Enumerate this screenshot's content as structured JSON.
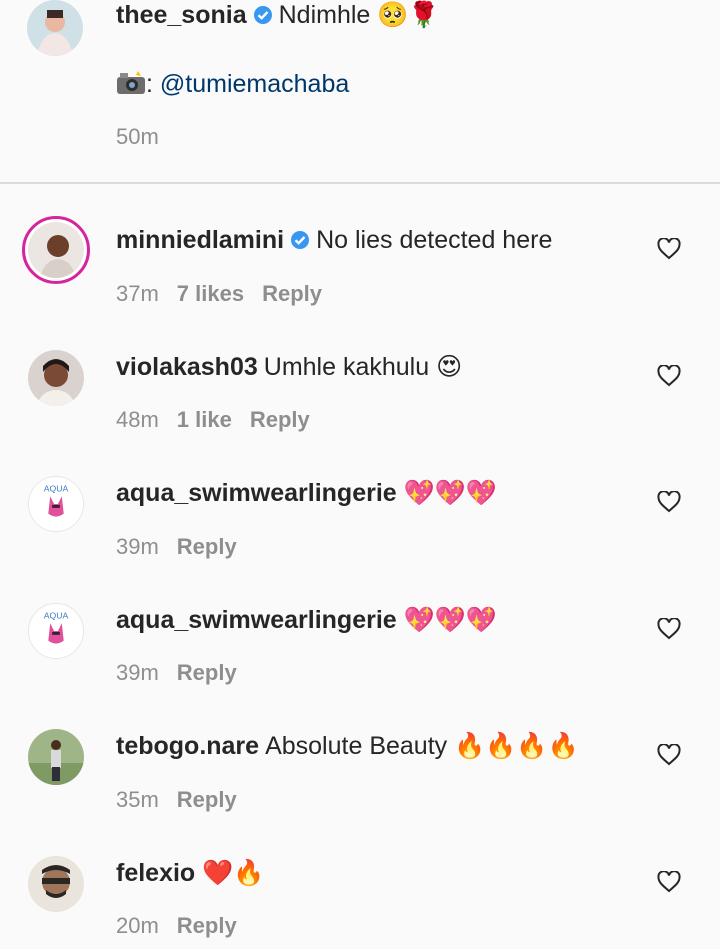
{
  "caption": {
    "username": "thee_sonia",
    "text": "Ndimhle",
    "emojis": "🥺🌹",
    "camera_icon": "camera-flash-icon",
    "credit_separator": ":",
    "credit_handle": "@tumiemachaba",
    "time": "50m"
  },
  "comments": [
    {
      "username": "minniedlamini",
      "verified": true,
      "text": "No lies detected here",
      "emojis": "",
      "time": "37m",
      "likes": "7 likes",
      "reply": "Reply"
    },
    {
      "username": "violakash03",
      "verified": false,
      "text": "Umhle kakhulu",
      "emojis": "😍",
      "time": "48m",
      "likes": "1 like",
      "reply": "Reply"
    },
    {
      "username": "aqua_swimwearlingerie",
      "verified": false,
      "text": "",
      "emojis": "💖💖💖",
      "time": "39m",
      "likes": "",
      "reply": "Reply"
    },
    {
      "username": "aqua_swimwearlingerie",
      "verified": false,
      "text": "",
      "emojis": "💖💖💖",
      "time": "39m",
      "likes": "",
      "reply": "Reply"
    },
    {
      "username": "tebogo.nare",
      "verified": false,
      "text": "Absolute Beauty",
      "emojis": "🔥🔥🔥🔥",
      "time": "35m",
      "likes": "",
      "reply": "Reply"
    },
    {
      "username": "felexio",
      "verified": false,
      "text": "",
      "emojis": "❤️🔥",
      "time": "20m",
      "likes": "",
      "reply": "Reply"
    }
  ],
  "aqua_logo_text": "AQUA",
  "colors": {
    "verified": "#3897f0",
    "meta": "#8e8e8e",
    "mention": "#00376b",
    "story_ring": "#d6249f"
  }
}
